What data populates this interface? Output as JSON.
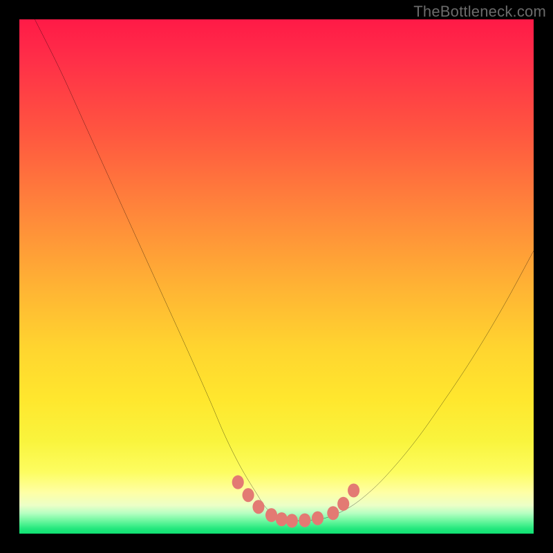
{
  "watermark": "TheBottleneck.com",
  "colors": {
    "frame": "#000000",
    "curve": "#000000",
    "marker": "#e37a73",
    "gradient_top": "#ff1a47",
    "gradient_bottom": "#0fe273"
  },
  "chart_data": {
    "type": "line",
    "title": "",
    "xlabel": "",
    "ylabel": "",
    "xlim": [
      0,
      100
    ],
    "ylim": [
      0,
      100
    ],
    "grid": false,
    "legend": false,
    "note": "Values are read off the plot in percent of plot area. x runs left→right, y runs 0=bottom→100=top. The curve depicts a bottleneck-style V shape with a flat minimum.",
    "series": [
      {
        "name": "curve",
        "x": [
          3,
          8,
          13,
          18,
          23,
          28,
          33,
          37,
          40,
          43,
          46,
          48,
          50,
          52,
          54,
          57,
          60,
          64,
          68,
          72,
          77,
          82,
          88,
          94,
          100
        ],
        "y": [
          100,
          90,
          79,
          68,
          57,
          46,
          35,
          26,
          19,
          13,
          8,
          5,
          3.2,
          2.6,
          2.5,
          2.6,
          3.2,
          5,
          8,
          12,
          18,
          25,
          34,
          44,
          55
        ]
      }
    ],
    "markers": {
      "name": "highlight-points",
      "color": "#e37a73",
      "x": [
        42.5,
        44.5,
        46.5,
        49,
        51,
        53,
        55.5,
        58,
        61,
        63,
        65
      ],
      "y": [
        10,
        7.5,
        5.2,
        3.6,
        2.8,
        2.5,
        2.6,
        3,
        4,
        5.8,
        8.4
      ]
    }
  }
}
